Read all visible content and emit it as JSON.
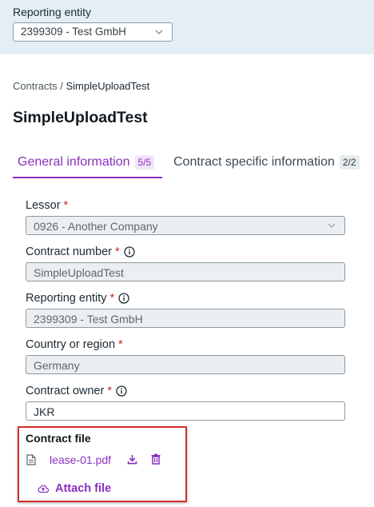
{
  "header": {
    "label": "Reporting entity",
    "selected": "2399309 - Test GmbH"
  },
  "breadcrumb": {
    "parent": "Contracts",
    "separator": " / ",
    "current": "SimpleUploadTest"
  },
  "page_title": "SimpleUploadTest",
  "tabs": [
    {
      "label": "General information",
      "badge": "5/5",
      "active": true
    },
    {
      "label": "Contract specific information",
      "badge": "2/2",
      "active": false
    }
  ],
  "form": {
    "lessor": {
      "label": "Lessor",
      "required_mark": "*",
      "value": "0926 - Another Company"
    },
    "contract_number": {
      "label": "Contract number",
      "required_mark": "*",
      "value": "SimpleUploadTest"
    },
    "reporting_entity": {
      "label": "Reporting entity",
      "required_mark": "*",
      "value": "2399309 - Test GmbH"
    },
    "country": {
      "label": "Country or region",
      "required_mark": "*",
      "value": "Germany"
    },
    "contract_owner": {
      "label": "Contract owner",
      "required_mark": "*",
      "value": "JKR"
    }
  },
  "contract_file": {
    "heading": "Contract file",
    "file_name": "lease-01.pdf",
    "attach_label": "Attach file"
  },
  "colors": {
    "accent": "#8a2fbf",
    "header_background": "#e3eff4",
    "highlight_border": "#d32f2f",
    "required": "#c62828"
  },
  "icons": [
    "chevron-down-icon",
    "info-icon",
    "document-icon",
    "download-icon",
    "trash-icon",
    "cloud-upload-icon"
  ]
}
